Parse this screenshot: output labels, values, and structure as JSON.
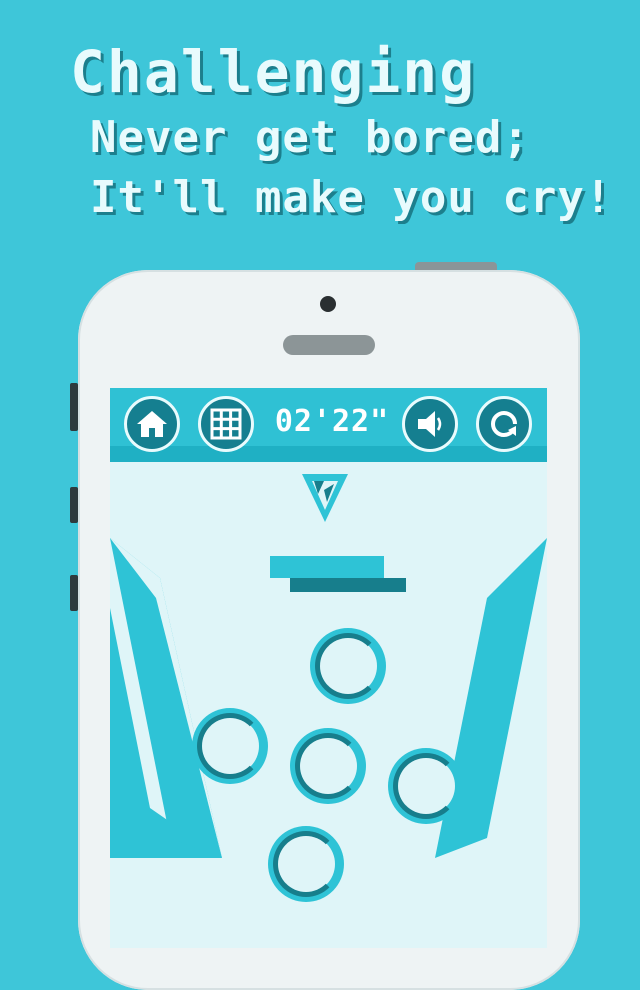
{
  "headline": {
    "title": "Challenging",
    "line1": "Never get bored;",
    "line2": "It'll make you cry!"
  },
  "game": {
    "timer": "02'22\"",
    "buttons": {
      "home_icon": "home-icon",
      "levels_icon": "grid-icon",
      "sound_icon": "speaker-icon",
      "restart_icon": "restart-icon"
    }
  },
  "colors": {
    "background": "#3ec6d9",
    "accent": "#2fc1d4",
    "dark_accent": "#157f90",
    "screen": "#dff5f8"
  }
}
